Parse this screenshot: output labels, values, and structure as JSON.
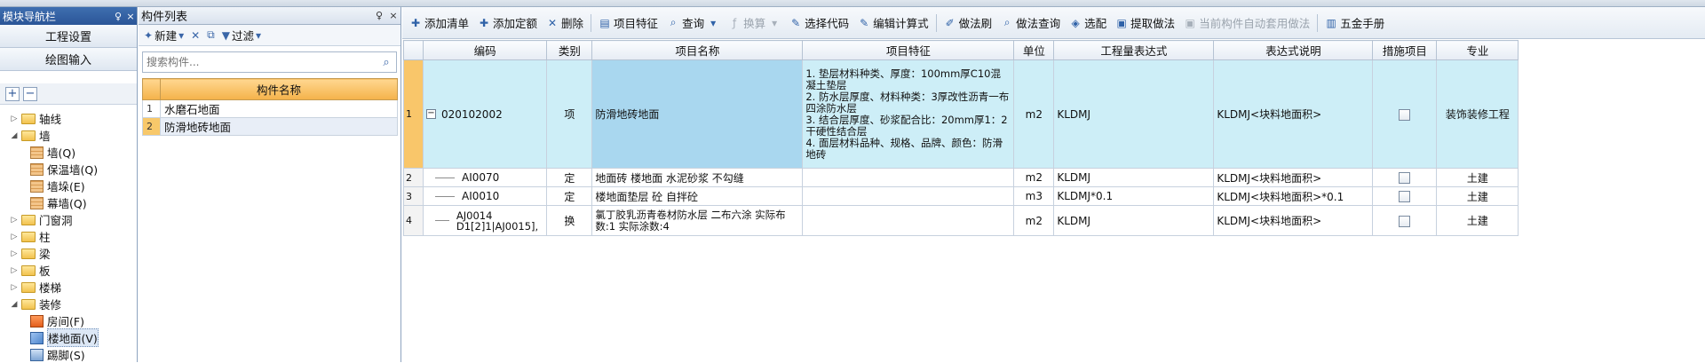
{
  "nav": {
    "title": "模块导航栏",
    "pin": "♀",
    "close": "×",
    "buttons": [
      "工程设置",
      "绘图输入"
    ],
    "tree": [
      {
        "label": "轴线",
        "level": 0,
        "expander": "▷",
        "icon": "folder"
      },
      {
        "label": "墙",
        "level": 0,
        "expander": "◢",
        "icon": "folder"
      },
      {
        "label": "墙(Q)",
        "level": 1,
        "icon": "wall"
      },
      {
        "label": "保温墙(Q)",
        "level": 1,
        "icon": "wall"
      },
      {
        "label": "墙垛(E)",
        "level": 1,
        "icon": "wall"
      },
      {
        "label": "幕墙(Q)",
        "level": 1,
        "icon": "wall"
      },
      {
        "label": "门窗洞",
        "level": 0,
        "expander": "▷",
        "icon": "folder"
      },
      {
        "label": "柱",
        "level": 0,
        "expander": "▷",
        "icon": "folder"
      },
      {
        "label": "梁",
        "level": 0,
        "expander": "▷",
        "icon": "folder"
      },
      {
        "label": "板",
        "level": 0,
        "expander": "▷",
        "icon": "folder"
      },
      {
        "label": "楼梯",
        "level": 0,
        "expander": "▷",
        "icon": "folder"
      },
      {
        "label": "装修",
        "level": 0,
        "expander": "◢",
        "icon": "folder"
      },
      {
        "label": "房间(F)",
        "level": 1,
        "icon": "room"
      },
      {
        "label": "楼地面(V)",
        "level": 1,
        "icon": "floor",
        "selected": true
      },
      {
        "label": "踢脚(S)",
        "level": 1,
        "icon": "skirt"
      }
    ]
  },
  "component_list": {
    "title": "构件列表",
    "pin": "♀",
    "close": "×",
    "new_label": "新建",
    "filter_label": "过滤",
    "search_placeholder": "搜索构件...",
    "header": "构件名称",
    "rows": [
      {
        "index": "1",
        "name": "水磨石地面"
      },
      {
        "index": "2",
        "name": "防滑地砖地面",
        "selected": true
      }
    ]
  },
  "toolbar": [
    {
      "label": "添加清单",
      "icon": "add-list-icon",
      "glyph": "✚"
    },
    {
      "label": "添加定额",
      "icon": "add-quota-icon",
      "glyph": "✚"
    },
    {
      "label": "删除",
      "icon": "delete-icon",
      "glyph": "✕"
    },
    {
      "sep": true
    },
    {
      "label": "项目特征",
      "icon": "feature-icon",
      "glyph": "▤"
    },
    {
      "label": "查询",
      "icon": "search-icon",
      "glyph": "⌕",
      "dropdown": true
    },
    {
      "label": "换算",
      "icon": "fx-icon",
      "glyph": "ƒ",
      "dropdown": true,
      "disabled": true
    },
    {
      "label": "选择代码",
      "icon": "select-code-icon",
      "glyph": "✎"
    },
    {
      "label": "编辑计算式",
      "icon": "edit-formula-icon",
      "glyph": "✎"
    },
    {
      "sep": true
    },
    {
      "label": "做法刷",
      "icon": "brush-icon",
      "glyph": "✐"
    },
    {
      "label": "做法查询",
      "icon": "method-query-icon",
      "glyph": "⌕"
    },
    {
      "label": "选配",
      "icon": "match-icon",
      "glyph": "◈"
    },
    {
      "label": "提取做法",
      "icon": "extract-icon",
      "glyph": "▣"
    },
    {
      "label": "当前构件自动套用做法",
      "icon": "auto-apply-icon",
      "glyph": "▣",
      "disabled": true
    },
    {
      "sep": true
    },
    {
      "label": "五金手册",
      "icon": "hardware-manual-icon",
      "glyph": "▥"
    }
  ],
  "grid": {
    "headers": [
      "编码",
      "类别",
      "项目名称",
      "项目特征",
      "单位",
      "工程量表达式",
      "表达式说明",
      "措施项目",
      "专业"
    ],
    "rows": [
      {
        "num": "1",
        "code": "020102002",
        "category": "项",
        "name": "防滑地砖地面",
        "features": "1. 垫层材料种类、厚度：100mm厚C10混凝土垫层\n2. 防水层厚度、材料种类：3厚改性沥青一布四涂防水层\n3. 结合层厚度、砂浆配合比：20mm厚1：2干硬性结合层\n4. 面层材料品种、规格、品牌、颜色：防滑地砖",
        "unit": "m2",
        "expression": "KLDMJ",
        "expression_desc": "KLDMJ<块料地面积>",
        "measure": false,
        "specialty": "装饰装修工程"
      },
      {
        "num": "2",
        "code": "AI0070",
        "category": "定",
        "name": "地面砖 楼地面 水泥砂浆 不勾缝",
        "features": "",
        "unit": "m2",
        "expression": "KLDMJ",
        "expression_desc": "KLDMJ<块料地面积>",
        "measure": false,
        "specialty": "土建"
      },
      {
        "num": "3",
        "code": "AI0010",
        "category": "定",
        "name": "楼地面垫层 砼 自拌砼",
        "features": "",
        "unit": "m3",
        "expression": "KLDMJ*0.1",
        "expression_desc": "KLDMJ<块料地面积>*0.1",
        "measure": false,
        "specialty": "土建"
      },
      {
        "num": "4",
        "code": "AJ0014 D1[2]1|AJ0015],",
        "category": "换",
        "name": "氯丁胶乳沥青卷材防水层 二布六涂 实际布数:1 实际涂数:4",
        "features": "",
        "unit": "m2",
        "expression": "KLDMJ",
        "expression_desc": "KLDMJ<块料地面积>",
        "measure": false,
        "specialty": "土建"
      }
    ]
  }
}
